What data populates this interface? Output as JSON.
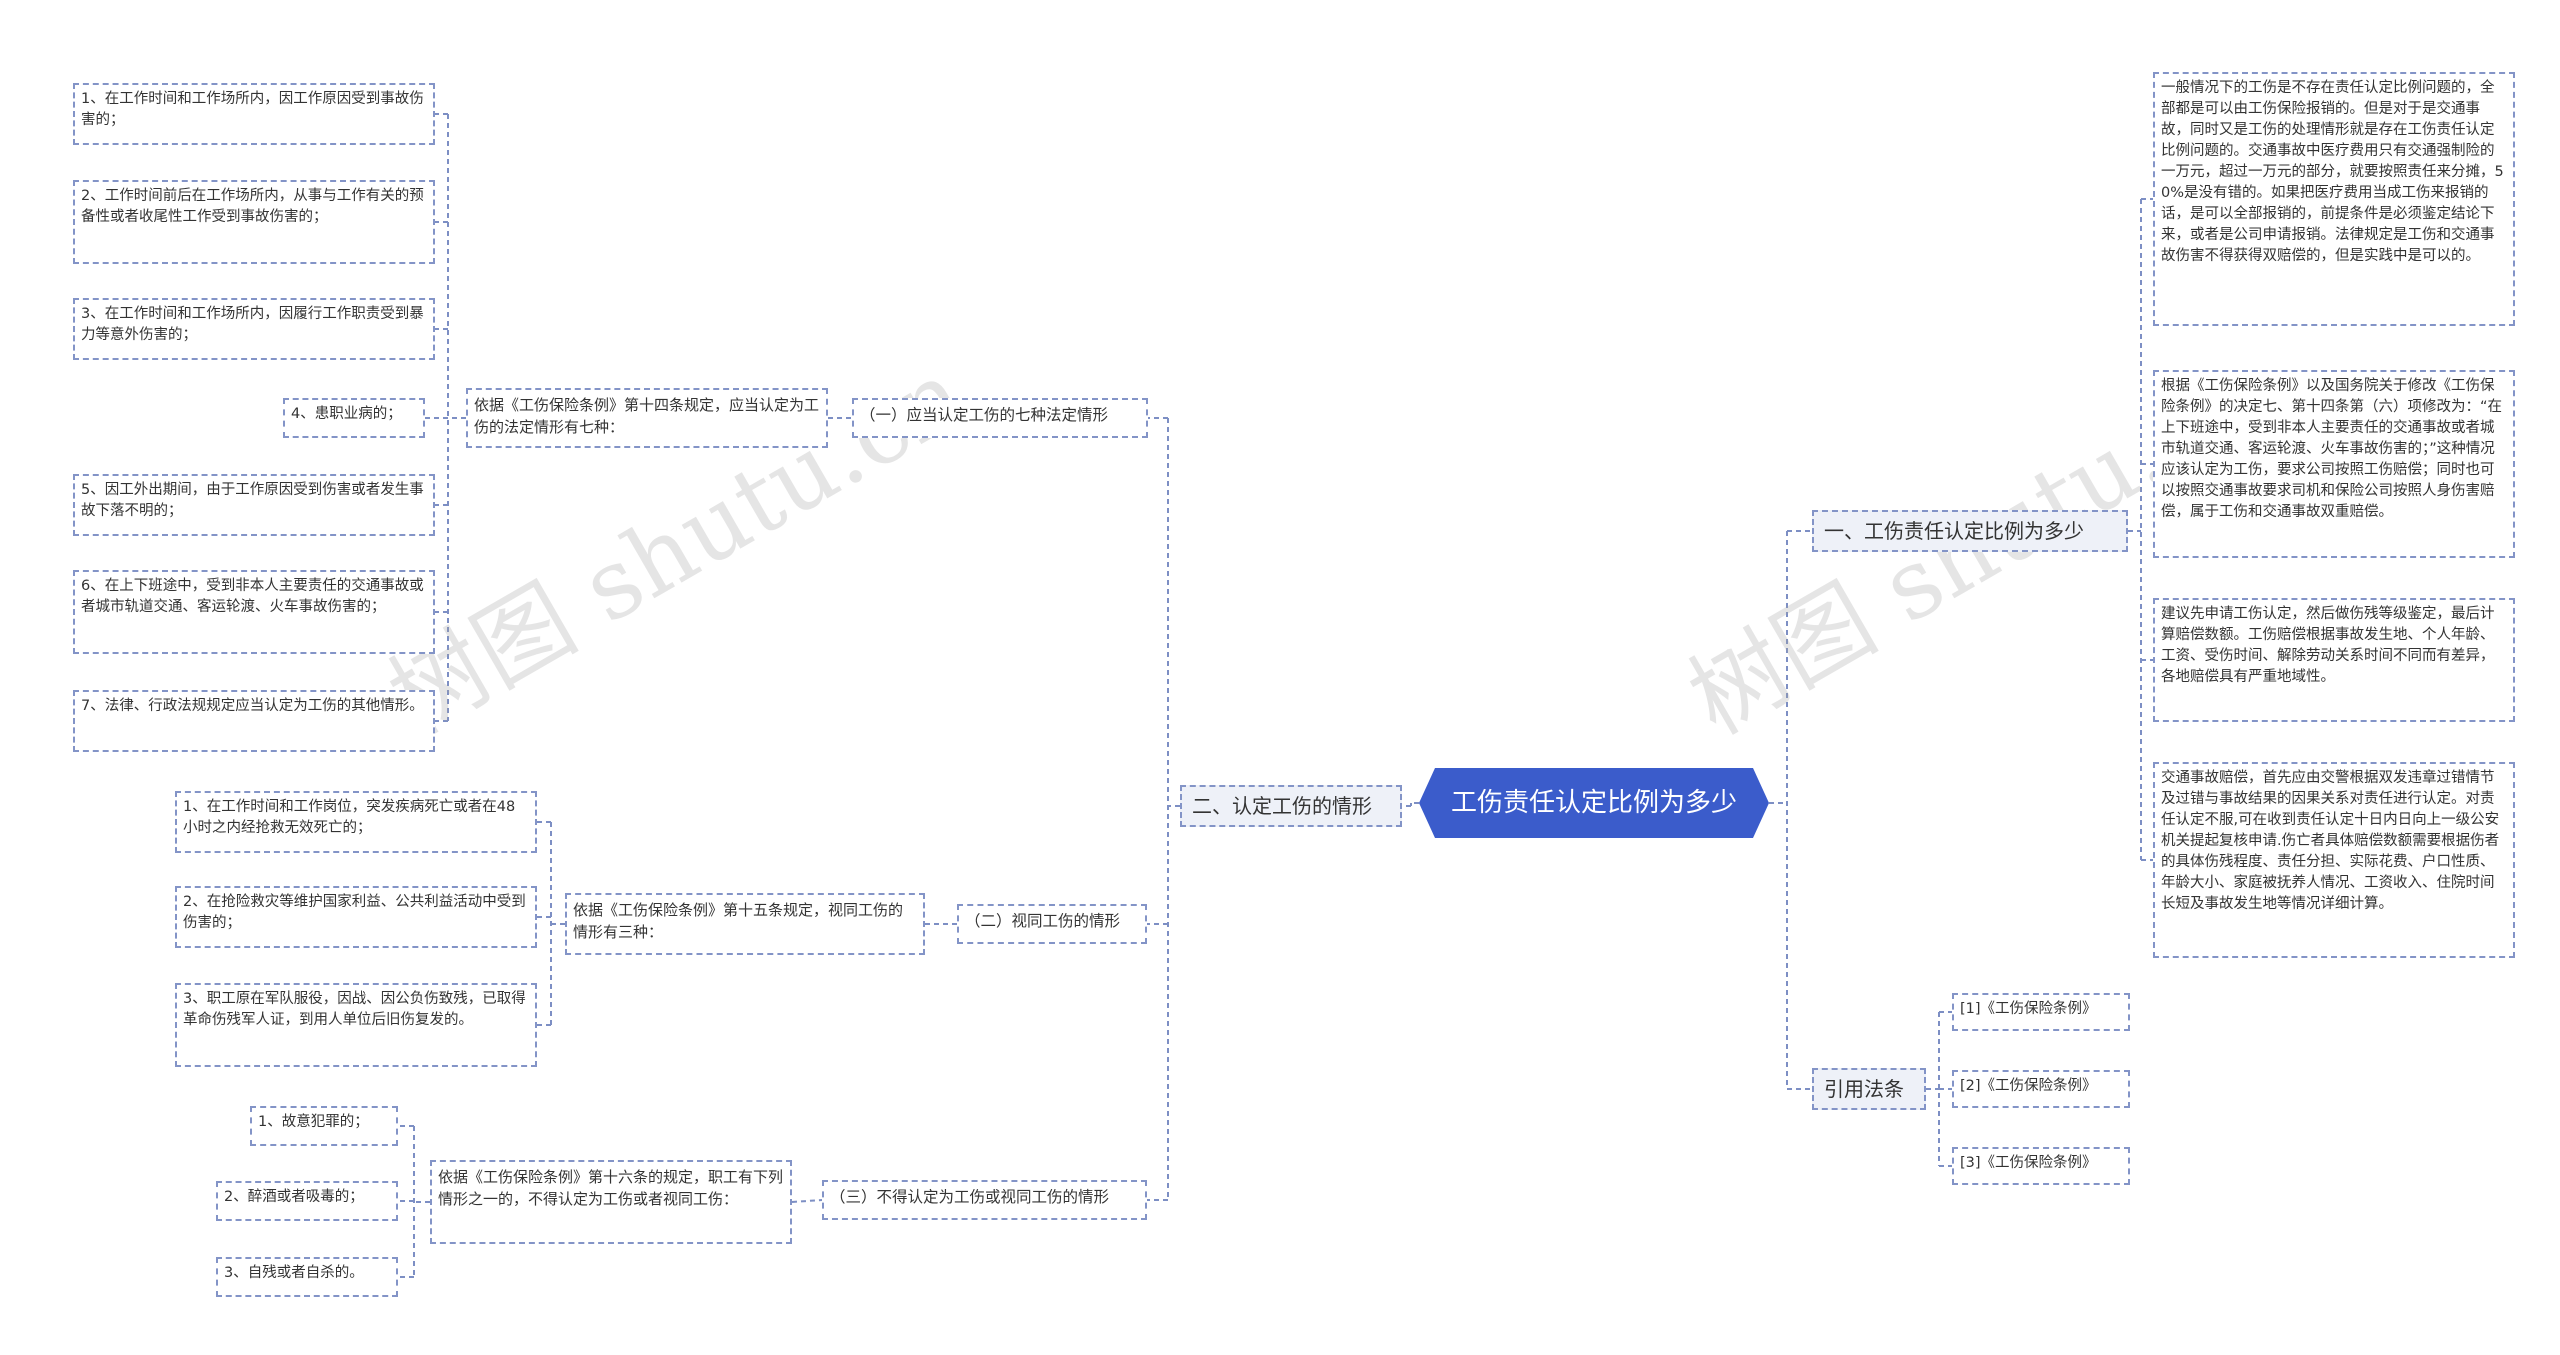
{
  "root": {
    "title": "工伤责任认定比例为多少"
  },
  "branches": {
    "situations": {
      "label": "二、认定工伤的情形",
      "seven": {
        "label": "（一）应当认定工伤的七种法定情形",
        "intro": "依据《工伤保险条例》第十四条规定，应当认定为工伤的法定情形有七种：",
        "items": [
          "1、在工作时间和工作场所内，因工作原因受到事故伤害的；",
          "2、工作时间前后在工作场所内，从事与工作有关的预备性或者收尾性工作受到事故伤害的；",
          "3、在工作时间和工作场所内，因履行工作职责受到暴力等意外伤害的；",
          "4、患职业病的；",
          "5、因工外出期间，由于工作原因受到伤害或者发生事故下落不明的；",
          "6、在上下班途中，受到非本人主要责任的交通事故或者城市轨道交通、客运轮渡、火车事故伤害的；",
          "7、法律、行政法规规定应当认定为工伤的其他情形。"
        ]
      },
      "deemed": {
        "label": "（二）视同工伤的情形",
        "intro": "依据《工伤保险条例》第十五条规定，视同工伤的情形有三种：",
        "items": [
          "1、在工作时间和工作岗位，突发疾病死亡或者在48小时之内经抢救无效死亡的；",
          "2、在抢险救灾等维护国家利益、公共利益活动中受到伤害的；",
          "3、职工原在军队服役，因战、因公负伤致残，已取得革命伤残军人证，到用人单位后旧伤复发的。"
        ]
      },
      "excluded": {
        "label": "（三）不得认定为工伤或视同工伤的情形",
        "intro": "依据《工伤保险条例》第十六条的规定，职工有下列情形之一的，不得认定为工伤或者视同工伤：",
        "items": [
          "1、故意犯罪的；",
          "2、醉酒或者吸毒的；",
          "3、自残或者自杀的。"
        ]
      }
    },
    "ratio": {
      "label": "一、工伤责任认定比例为多少",
      "items": [
        "一般情况下的工伤是不存在责任认定比例问题的，全部都是可以由工伤保险报销的。但是对于是交通事故，同时又是工伤的处理情形就是存在工伤责任认定比例问题的。交通事故中医疗费用只有交通强制险的一万元，超过一万元的部分，就要按照责任来分摊，50%是没有错的。如果把医疗费用当成工伤来报销的话，是可以全部报销的，前提条件是必须鉴定结论下来，或者是公司申请报销。法律规定是工伤和交通事故伤害不得获得双赔偿的，但是实践中是可以的。",
        "根据《工伤保险条例》以及国务院关于修改《工伤保险条例》的决定七、第十四条第（六）项修改为：“在上下班途中，受到非本人主要责任的交通事故或者城市轨道交通、客运轮渡、火车事故伤害的；”这种情况应该认定为工伤，要求公司按照工伤赔偿；同时也可以按照交通事故要求司机和保险公司按照人身伤害赔偿，属于工伤和交通事故双重赔偿。",
        "建议先申请工伤认定，然后做伤残等级鉴定，最后计算赔偿数额。工伤赔偿根据事故发生地、个人年龄、工资、受伤时间、解除劳动关系时间不同而有差异，各地赔偿具有严重地域性。",
        "交通事故赔偿，首先应由交警根据双发违章过错情节及过错与事故结果的因果关系对责任进行认定。对责任认定不服,可在收到责任认定十日内日向上一级公安机关提起复核申请.伤亡者具体赔偿数额需要根据伤者的具体伤残程度、责任分担、实际花费、户口性质、年龄大小、家庭被抚养人情况、工资收入、住院时间长短及事故发生地等情况详细计算。"
      ]
    },
    "laws": {
      "label": "引用法条",
      "items": [
        "[1]《工伤保险条例》",
        "[2]《工伤保险条例》",
        "[3]《工伤保险条例》"
      ]
    }
  },
  "watermark": "树图 shutu.cn",
  "colors": {
    "root_fill": "#3b5ccb",
    "border": "#8394c7",
    "line": "#7d8fc4"
  }
}
